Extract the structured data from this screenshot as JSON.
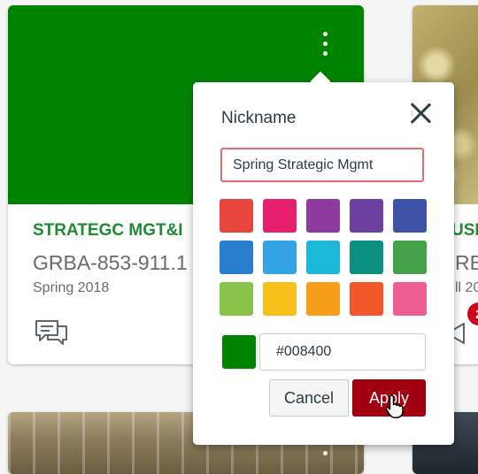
{
  "cards": {
    "main": {
      "color": "#008400",
      "title": "STRATEGC MGT&I",
      "code": "GRBA-853-911.1",
      "term": "Spring 2018",
      "icons": [
        "more-vertical-icon",
        "discussion-icon"
      ]
    },
    "right": {
      "title": "USI",
      "code": "RB",
      "term": "ll 20",
      "badge": "2",
      "icons": [
        "announcement-icon"
      ]
    }
  },
  "popover": {
    "title": "Nickname",
    "nickname_value": "Spring Strategic Mgmt",
    "swatches": [
      "#e8463c",
      "#e81e6e",
      "#8e3a9e",
      "#6a3fa0",
      "#3e52a8",
      "#2a7fcc",
      "#33a3e6",
      "#1bb8d8",
      "#0c9080",
      "#46a14c",
      "#8bc34a",
      "#f8c01a",
      "#f89d1a",
      "#f2572a",
      "#ee5e92"
    ],
    "selected_color": "#008400",
    "hex_value": "#008400",
    "cancel_label": "Cancel",
    "apply_label": "Apply"
  }
}
